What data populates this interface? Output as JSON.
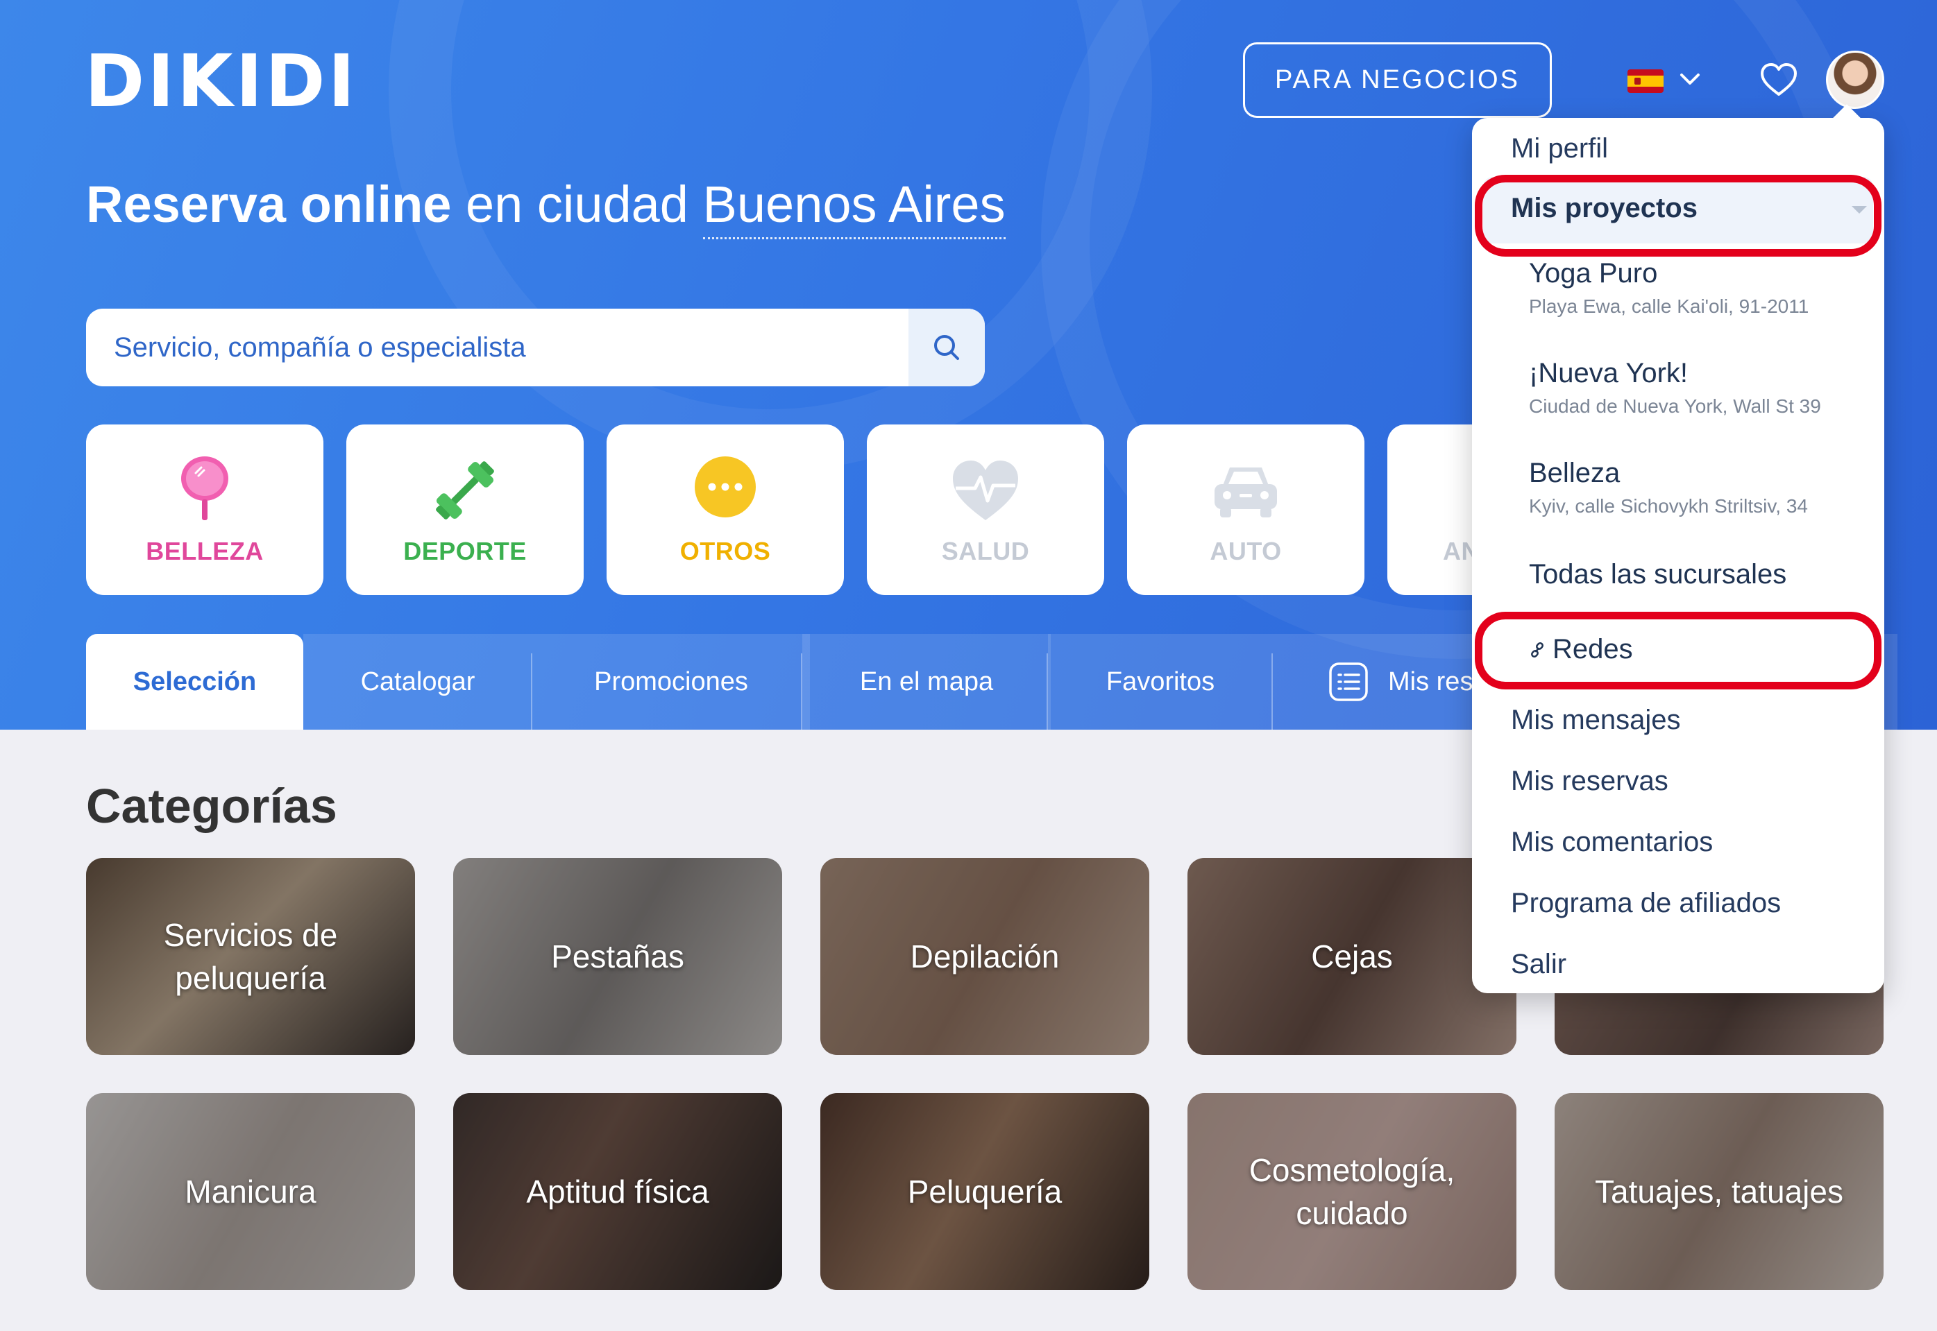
{
  "brand": {
    "logo": "DIKIDI"
  },
  "header": {
    "business_button": "PARA NEGOCIOS",
    "language_flag": "es-flag-icon",
    "favorites_icon": "heart-icon",
    "avatar_icon": "user-avatar"
  },
  "hero": {
    "headline_bold": "Reserva online",
    "headline_rest": " en ciudad ",
    "city": "Buenos Aires"
  },
  "search": {
    "placeholder": "Servicio, compañía o especialista",
    "icon": "search-icon"
  },
  "service_categories": [
    {
      "label": "BELLEZA",
      "color": "#e0479b",
      "icon": "mirror-icon"
    },
    {
      "label": "DEPORTE",
      "color": "#3bb04f",
      "icon": "dumbbell-icon"
    },
    {
      "label": "OTROS",
      "color": "#f0b000",
      "icon": "more-icon"
    },
    {
      "label": "SALUD",
      "color": "#c4cad4",
      "icon": "heart-pulse-icon"
    },
    {
      "label": "AUTO",
      "color": "#c4cad4",
      "icon": "car-icon"
    },
    {
      "label": "AN",
      "color": "#c4cad4",
      "icon": ""
    }
  ],
  "tabs": [
    {
      "label": "Selección"
    },
    {
      "label": "Catalogar"
    },
    {
      "label": "Promociones"
    },
    {
      "label": "En el mapa"
    },
    {
      "label": "Favoritos"
    },
    {
      "label": "Mis res"
    }
  ],
  "categories_title": "Categorías",
  "category_tiles": [
    {
      "label": "Servicios de peluquería"
    },
    {
      "label": "Pestañas"
    },
    {
      "label": "Depilación"
    },
    {
      "label": "Cejas"
    },
    {
      "label": ""
    },
    {
      "label": "Manicura"
    },
    {
      "label": "Aptitud física"
    },
    {
      "label": "Peluquería"
    },
    {
      "label": "Cosmetología, cuidado"
    },
    {
      "label": "Tatuajes, tatuajes"
    }
  ],
  "menu": {
    "profile": "Mi perfil",
    "projects": "Mis proyectos",
    "project_items": [
      {
        "name": "Yoga Puro",
        "address": "Playa Ewa, calle Kai'oli, 91-2011"
      },
      {
        "name": "¡Nueva York!",
        "address": "Ciudad de Nueva York, Wall St 39"
      },
      {
        "name": "Belleza",
        "address": "Kyiv, calle Sichovykh Striltsiv, 34"
      }
    ],
    "all_branches": "Todas las sucursales",
    "networks": "Redes",
    "messages": "Mis mensajes",
    "bookings": "Mis reservas",
    "comments": "Mis comentarios",
    "affiliates": "Programa de afiliados",
    "logout": "Salir"
  },
  "colors": {
    "hero_blue": "#3476e4",
    "highlight_red": "#e3001b",
    "tab_active_text": "#2d6bd4"
  }
}
